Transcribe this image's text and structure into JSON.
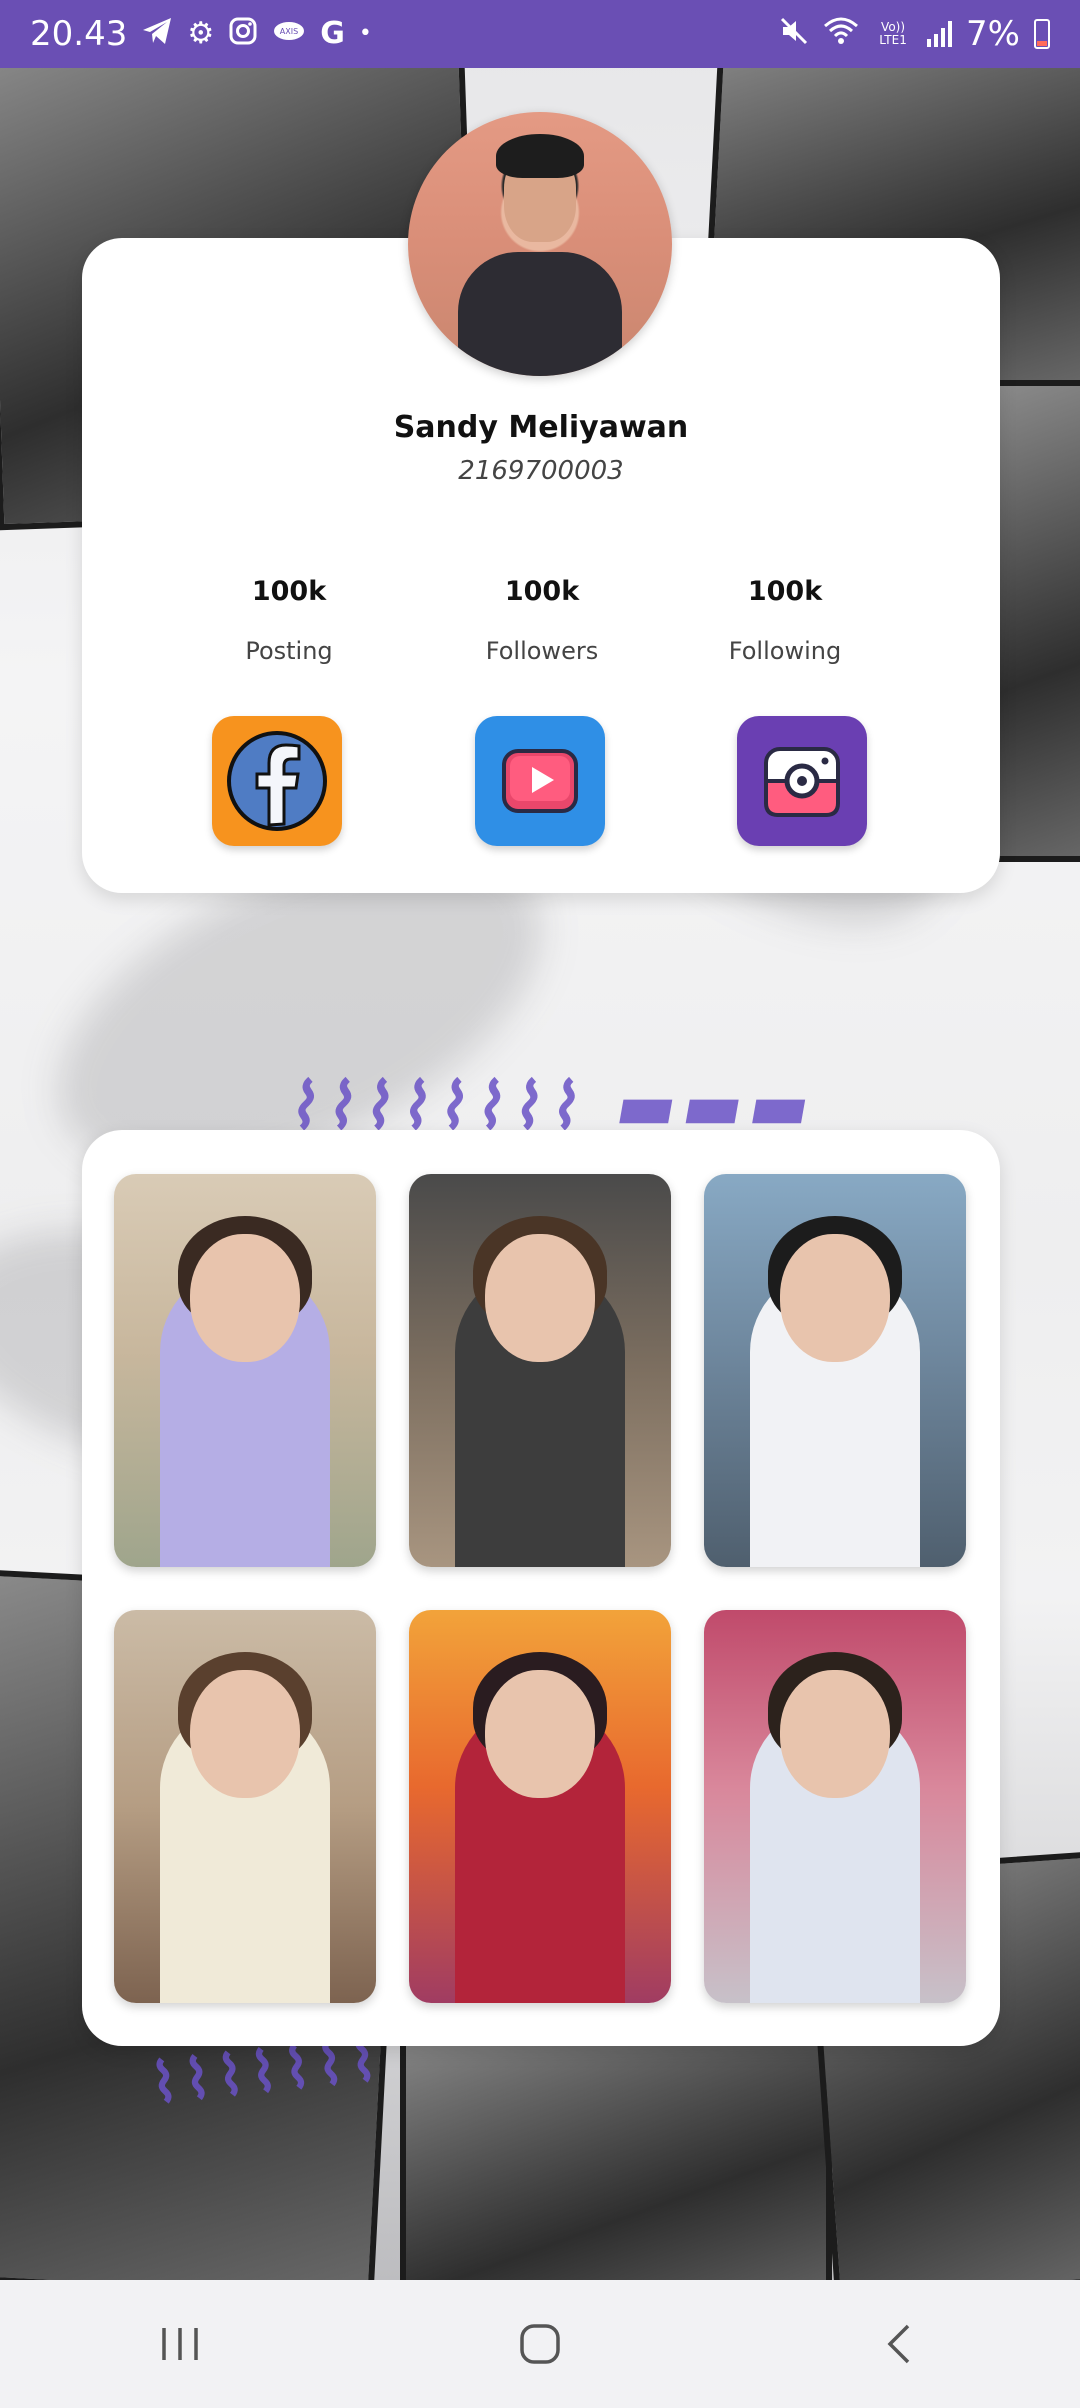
{
  "status_bar": {
    "time": "20.43",
    "network_label": "Vo)) LTE1",
    "battery": "7%",
    "icons": [
      "telegram-icon",
      "settings-icon",
      "instagram-icon",
      "axis-icon",
      "google-icon",
      "dot-icon",
      "mute-icon",
      "wifi-icon",
      "volte-icon",
      "signal-icon",
      "battery-icon"
    ]
  },
  "profile": {
    "name": "Sandy Meliyawan",
    "id": "2169700003",
    "stats": [
      {
        "value": "100k",
        "label": "Posting"
      },
      {
        "value": "100k",
        "label": "Followers"
      },
      {
        "value": "100k",
        "label": "Following"
      }
    ],
    "social": [
      {
        "name": "facebook",
        "color": "#f7931e"
      },
      {
        "name": "youtube",
        "color": "#2f8fe6"
      },
      {
        "name": "camera",
        "color": "#6a3fb2"
      }
    ]
  },
  "gallery": {
    "count": 6
  },
  "colors": {
    "status_bar": "#6a4fb4",
    "card": "#ffffff"
  }
}
